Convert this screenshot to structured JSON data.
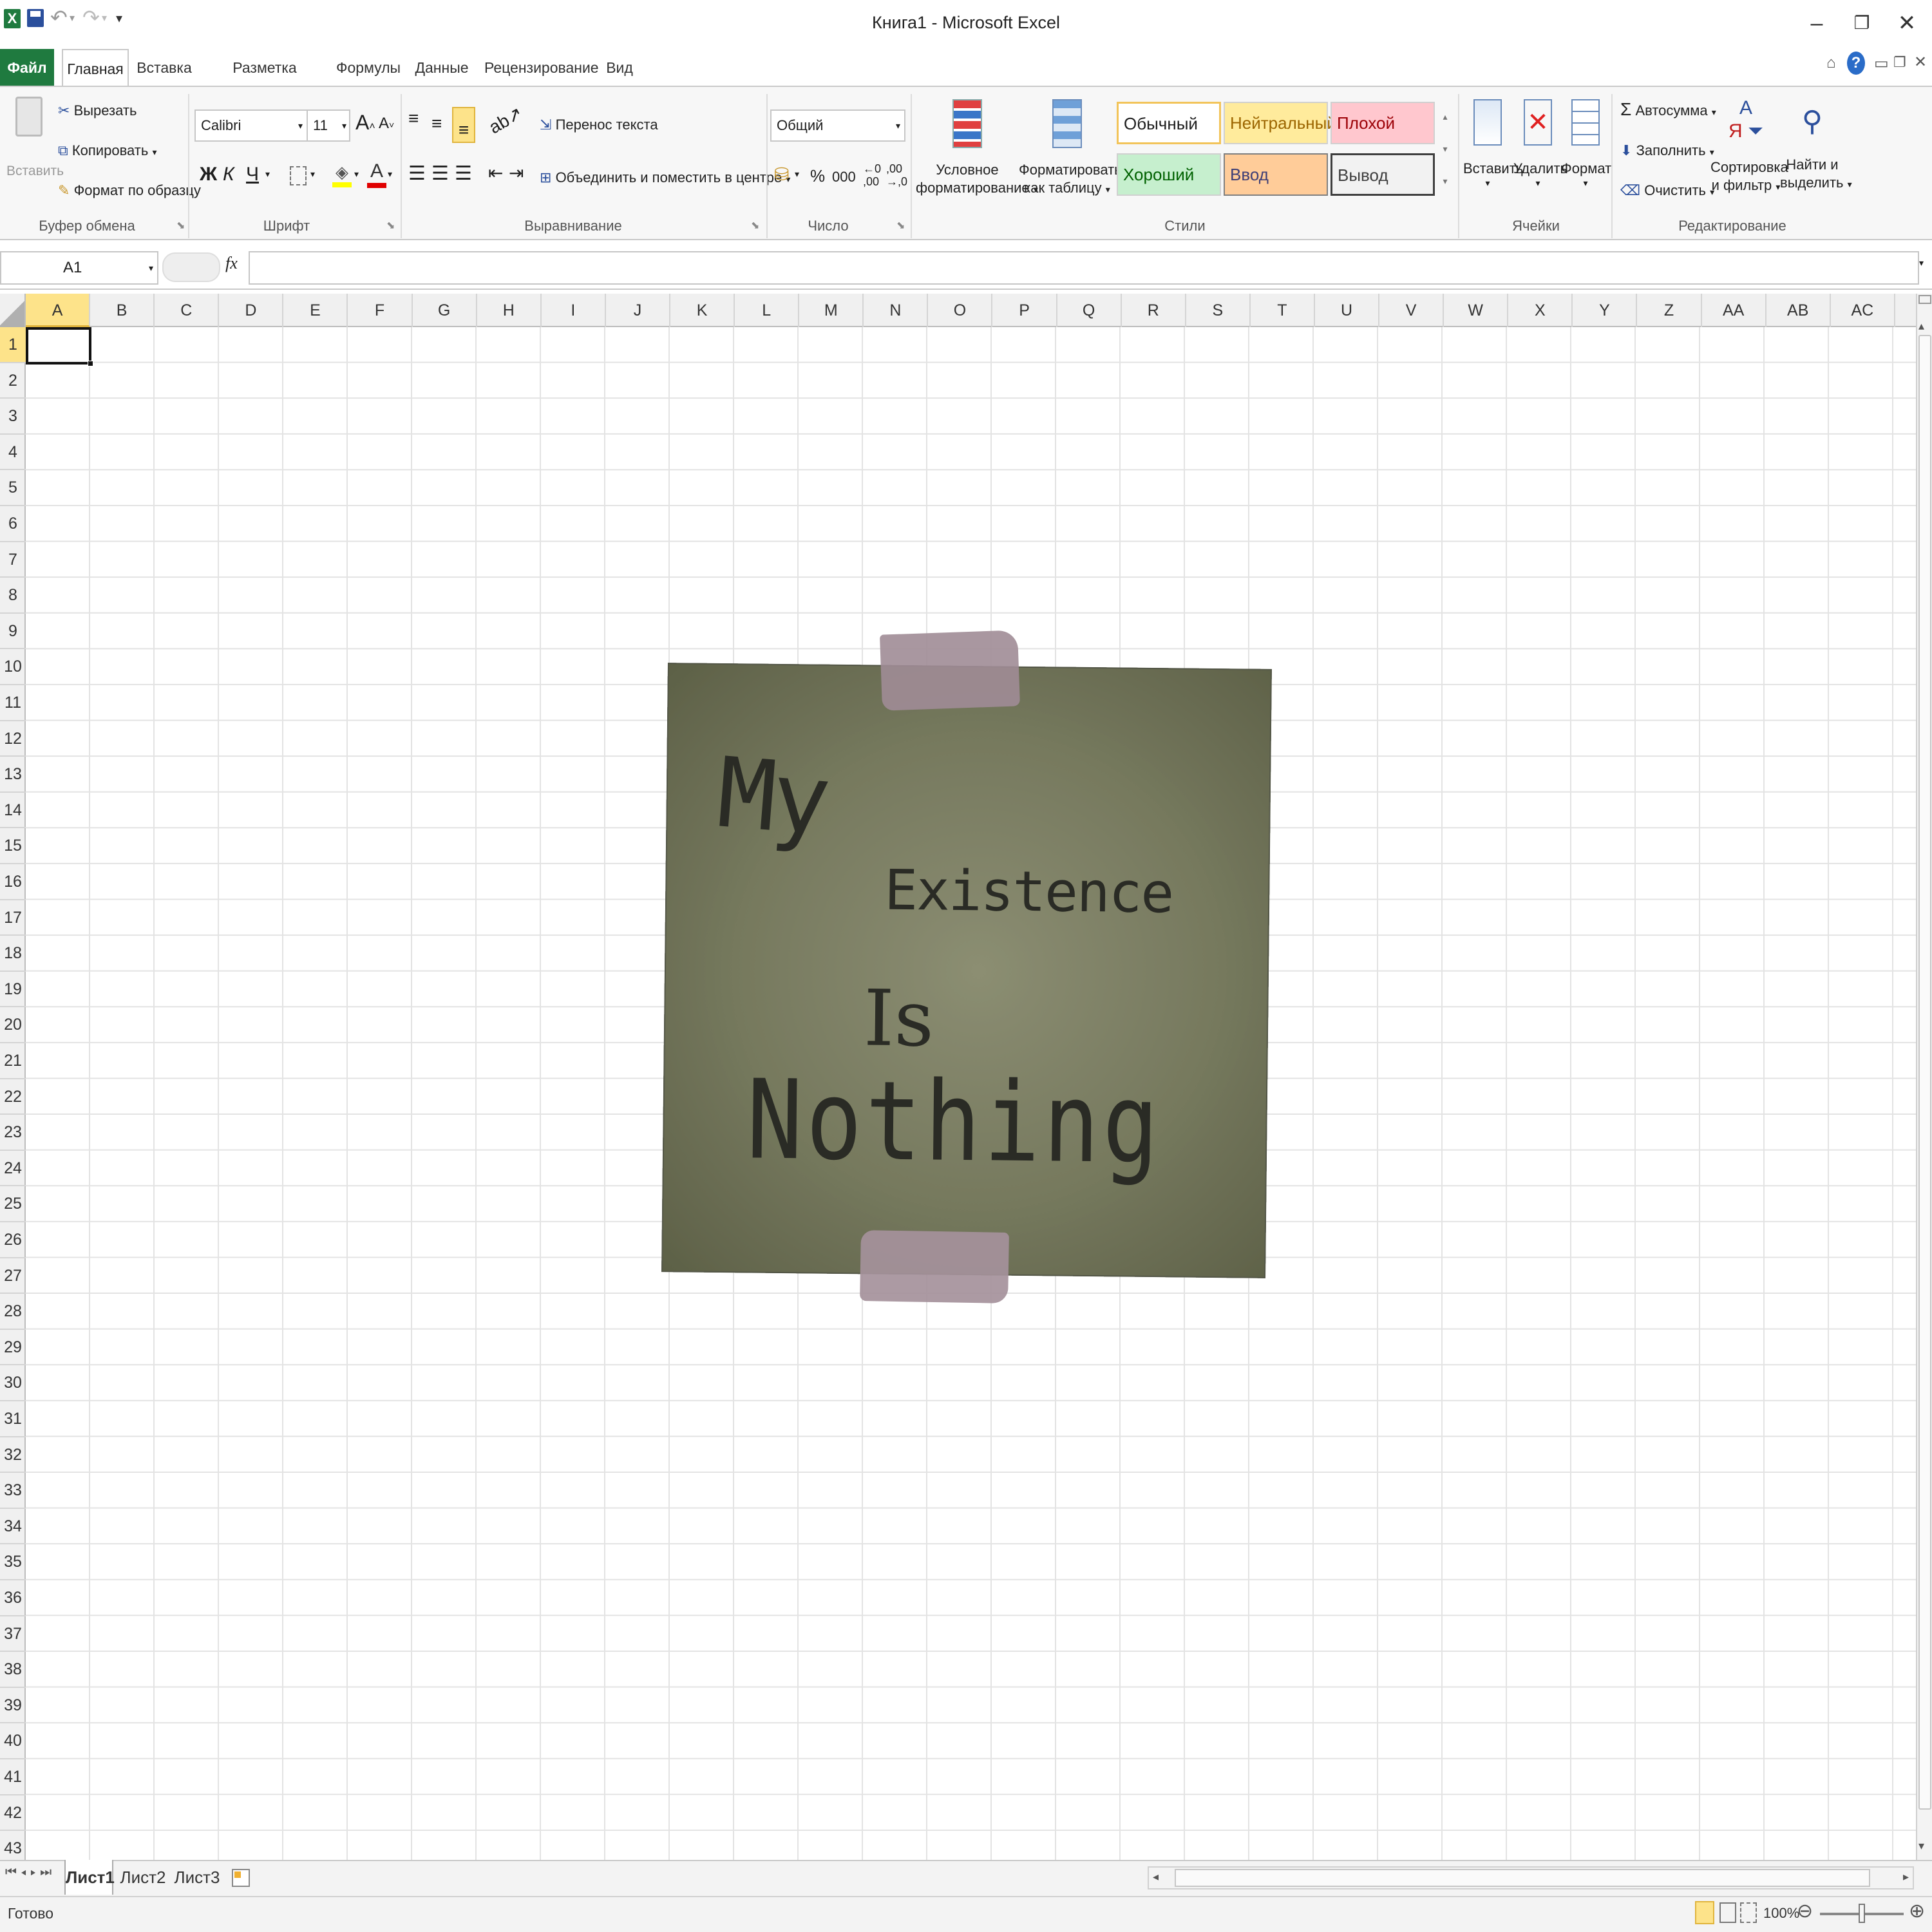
{
  "window": {
    "title": "Книга1 - Microsoft Excel"
  },
  "tabs": [
    {
      "label": "Файл"
    },
    {
      "label": "Главная"
    },
    {
      "label": "Вставка"
    },
    {
      "label": "Разметка страницы"
    },
    {
      "label": "Формулы"
    },
    {
      "label": "Данные"
    },
    {
      "label": "Рецензирование"
    },
    {
      "label": "Вид"
    }
  ],
  "clipboard": {
    "paste": "Вставить",
    "cut": "Вырезать",
    "copy": "Копировать",
    "format_painter": "Формат по образцу",
    "group": "Буфер обмена"
  },
  "font": {
    "name": "Calibri",
    "size": "11",
    "bold": "Ж",
    "italic": "К",
    "underline": "Ч",
    "group": "Шрифт"
  },
  "alignment": {
    "wrap": "Перенос текста",
    "merge": "Объединить и поместить в центре",
    "group": "Выравнивание"
  },
  "number": {
    "format": "Общий",
    "percent": "%",
    "thousands": "000",
    "group": "Число"
  },
  "styles": {
    "conditional_1": "Условное",
    "conditional_2": "форматирование",
    "as_table_1": "Форматировать",
    "as_table_2": "как таблицу",
    "normal": "Обычный",
    "neutral": "Нейтральный",
    "bad": "Плохой",
    "good": "Хороший",
    "input": "Ввод",
    "output": "Вывод",
    "group": "Стили",
    "colors": {
      "neutral_bg": "#ffeb9c",
      "neutral_fg": "#9c6500",
      "bad_bg": "#ffc7ce",
      "bad_fg": "#9c0006",
      "good_bg": "#c6efce",
      "good_fg": "#006100",
      "input_bg": "#ffcc99",
      "input_fg": "#3f3f76"
    }
  },
  "cells_group": {
    "insert": "Вставить",
    "delete": "Удалить",
    "format": "Формат",
    "group": "Ячейки"
  },
  "editing": {
    "autosum": "Автосумма",
    "fill": "Заполнить",
    "clear": "Очистить",
    "sort_1": "Сортировка",
    "sort_2": "и фильтр",
    "find_1": "Найти и",
    "find_2": "выделить",
    "group": "Редактирование"
  },
  "formula_bar": {
    "name_box": "A1",
    "fx": "fx",
    "value": ""
  },
  "columns": [
    "A",
    "B",
    "C",
    "D",
    "E",
    "F",
    "G",
    "H",
    "I",
    "J",
    "K",
    "L",
    "M",
    "N",
    "O",
    "P",
    "Q",
    "R",
    "S",
    "T",
    "U",
    "V",
    "W",
    "X",
    "Y",
    "Z",
    "AA",
    "AB",
    "AC"
  ],
  "rows": [
    "1",
    "2",
    "3",
    "4",
    "5",
    "6",
    "7",
    "8",
    "9",
    "10",
    "11",
    "12",
    "13",
    "14",
    "15",
    "16",
    "17",
    "18",
    "19",
    "20",
    "21",
    "22",
    "23",
    "24",
    "25",
    "26",
    "27",
    "28",
    "29",
    "30",
    "31",
    "32",
    "33",
    "34",
    "35",
    "36",
    "37",
    "38",
    "39",
    "40",
    "41",
    "42",
    "43"
  ],
  "note": {
    "line1": "My",
    "line2": "Existence",
    "line3": "Is",
    "line4": "Nothing"
  },
  "sheets": [
    "Лист1",
    "Лист2",
    "Лист3"
  ],
  "status": {
    "text": "Готово",
    "zoom": "100%"
  },
  "accent": "#1f7a3f"
}
